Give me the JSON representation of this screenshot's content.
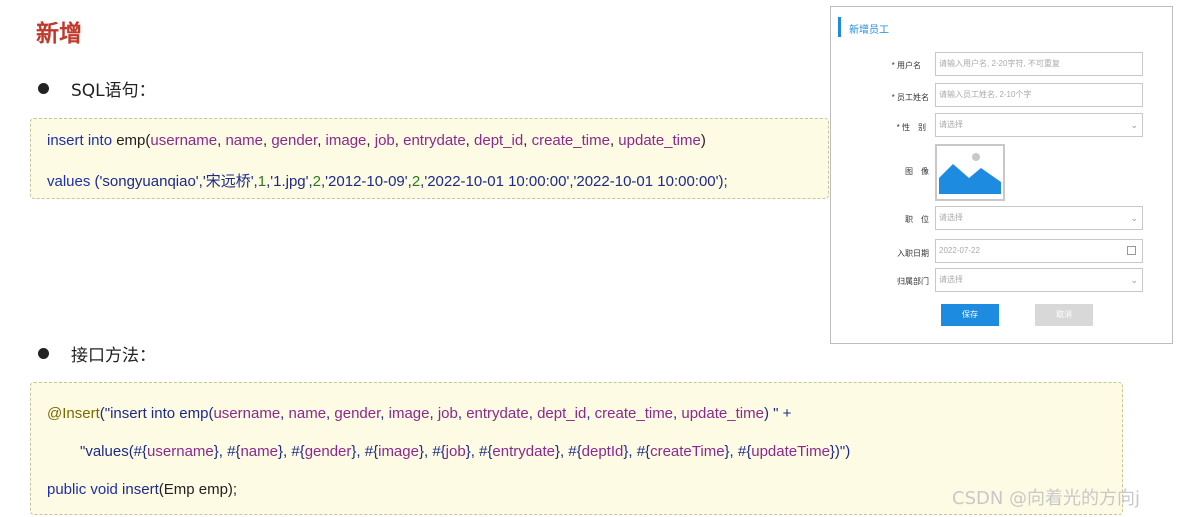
{
  "title": "新增",
  "section1": {
    "label": "SQL语句："
  },
  "sql": {
    "l1": {
      "k1": "insert into",
      "s1": " emp(",
      "f1": "username",
      "c1": ", ",
      "f2": "name",
      "c2": ", ",
      "f3": "gender",
      "c3": ", ",
      "f4": "image",
      "c4": ", ",
      "f5": "job",
      "c5": ", ",
      "f6": "entrydate",
      "c6": ", ",
      "f7": "dept_id",
      "c7": ", ",
      "f8": "create_time",
      "c8": ", ",
      "f9": "update_time",
      "end": ")"
    },
    "l2": {
      "k1": "values",
      "s1": " ('songyuanqiao','宋远桥',",
      "n1": "1",
      "s2": ",'1.jpg',",
      "n2": "2",
      "s3": ",'2012-10-09',",
      "n3": "2",
      "s4": ",'2022-10-01 10:00:00','2022-10-01 10:00:00');"
    }
  },
  "section2": {
    "label": "接口方法："
  },
  "java": {
    "l1": {
      "anno": "@Insert",
      "s1": "(\"",
      "k1": "insert into",
      "s2": " emp(",
      "f1": "username",
      "c1": ", ",
      "f2": "name",
      "c2": ", ",
      "f3": "gender",
      "c3": ", ",
      "f4": "image",
      "c4": ", ",
      "f5": "job",
      "c5": ", ",
      "f6": "entrydate",
      "c6": ", ",
      "f7": "dept_id",
      "c7": ", ",
      "f8": "create_time",
      "c8": ", ",
      "f9": "update_time",
      "end": ") \" +"
    },
    "l2": {
      "s1": "\"",
      "k1": "values",
      "s2": "(#{",
      "f1": "username",
      "c1": "}, #{",
      "f2": "name",
      "c2": "}, #{",
      "f3": "gender",
      "c3": "}, #{",
      "f4": "image",
      "c4": "}, #{",
      "f5": "job",
      "c5": "}, #{",
      "f6": "entrydate",
      "c6": "}, #{",
      "f7": "deptId",
      "c7": "}, #{",
      "f8": "createTime",
      "c8": "}, #{",
      "f9": "updateTime",
      "end": "})\")"
    },
    "l3": {
      "k1": "public void",
      "s1": " insert",
      "s2": "(Emp emp);"
    }
  },
  "form": {
    "title": "新增员工",
    "fields": {
      "username": {
        "label": "* 用户名",
        "placeholder": "请输入用户名, 2-20字符, 不可重复"
      },
      "name": {
        "label": "* 员工姓名",
        "placeholder": "请输入员工姓名, 2-10个字"
      },
      "gender": {
        "label": "* 性　别",
        "placeholder": "请选择"
      },
      "image": {
        "label": "图　像"
      },
      "job": {
        "label": "职　位",
        "placeholder": "请选择"
      },
      "entrydate": {
        "label": "入职日期",
        "value": "2022-07-22"
      },
      "dept": {
        "label": "归属部门",
        "placeholder": "请选择"
      }
    },
    "save_label": "保存",
    "cancel_label": "取消"
  },
  "watermark": "CSDN @向着光的方向j",
  "colors": {
    "title": "#c0392b",
    "keyword": "#1e2fa8",
    "field": "#8b2a8c",
    "number": "#2f7a1e",
    "accent": "#1d8ce0"
  }
}
